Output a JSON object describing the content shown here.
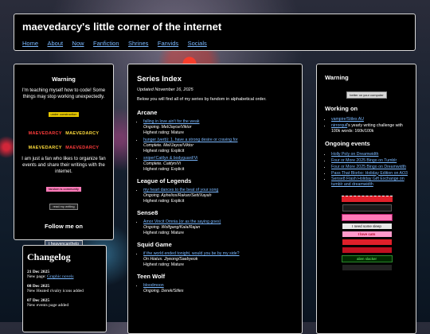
{
  "header": {
    "title": "maevedarcy's little corner of the internet",
    "nav": [
      "Home",
      "About",
      "Now",
      "Fanfiction",
      "Shrines",
      "Fanvids",
      "Socials"
    ]
  },
  "left": {
    "warning_heading": "Warning",
    "warning_text": "I'm teaching myself how to code! Some things may stop working unexpectedly.",
    "construction_badge": "under construction",
    "maeve_badge_text": "MAEVEDARCY",
    "fan_text": "I am just a fan who likes to organize fan events and share their writings with the internet.",
    "badge_pink": "fandom is community",
    "badge_reading": "read my writing",
    "follow_heading": "Follow me on",
    "tumblr_label": "heavencanthelp"
  },
  "changelog": {
    "title": "Changelog",
    "entries": [
      {
        "date": "21 Dec 2025",
        "prefix": "New page: ",
        "link": "Graphic novels",
        "suffix": ""
      },
      {
        "date": "08 Dec 2025",
        "prefix": "New Heated rivalry icons added",
        "link": "",
        "suffix": ""
      },
      {
        "date": "07 Dec 2025",
        "prefix": "New events page added",
        "link": "",
        "suffix": ""
      }
    ]
  },
  "center": {
    "title": "Series Index",
    "updated": "Updated November 16, 2025",
    "intro": "Below you will find all of my series by fandom in alphabetical order.",
    "fandoms": [
      {
        "name": "Arcane",
        "series": [
          {
            "title": "falling in love ain't for the weak",
            "status": "Ongoing. Mel/Jayce/Viktor",
            "rating": "Highest rating: Mature"
          },
          {
            "title": "hunger (verb): 1. have a strong desire or craving for",
            "status": "Complete. Mel/Jayce/Viktor",
            "rating": "Highest rating: Explicit"
          },
          {
            "title": "sniper!Caitlyn & bodyguard!Vi",
            "status": "Complete. Caitlyn/Vi",
            "rating": "Highest rating: Explicit"
          }
        ]
      },
      {
        "name": "League of Legends",
        "series": [
          {
            "title": "my heart dances to the beat of your song",
            "status": "Ongoing. Aphelios/Rakan/Sett/Xayah",
            "rating": "Highest rating: Explicit"
          }
        ]
      },
      {
        "name": "Sense8",
        "series": [
          {
            "title": "Amor Vincit Omnia (or as the saying goes)",
            "status": "Ongoing. Wolfgang/Kala/Rajan",
            "rating": "Highest rating: Mature"
          }
        ]
      },
      {
        "name": "Squid Game",
        "series": [
          {
            "title": "if the world ended tonight, would you be by my side?",
            "status": "On Hiatus. Jiyeong/Saebyeok",
            "rating": "Highest rating: Mature"
          }
        ]
      },
      {
        "name": "Teen Wolf",
        "series": [
          {
            "title": "bloodmoon",
            "status": "Ongoing. Derek/Stiles",
            "rating": ""
          }
        ]
      }
    ]
  },
  "right": {
    "warning_heading": "Warning",
    "warning_button": "better on your computer",
    "working_heading": "Working on",
    "working": [
      {
        "link": "vampire!Stiles AU",
        "text": ""
      },
      {
        "link": "nirrorquil",
        "text": "'s yearly writing challenge with 100k words: 160k/100k"
      }
    ],
    "events_heading": "Ongoing events",
    "events": [
      "Holly Poly on Dreamwidth",
      "Four or More 2025 Bingo on Tumblr",
      "Four or More 2025 Bingo on Dreamwidth",
      "Pass That Blorbo: Holiday Edition on AO3",
      "Sense8 Flash Holiday Gift Exchange on tumblr and dreamwidth"
    ],
    "stamps": [
      "",
      "",
      "",
      "I need some sleep",
      "I love cats",
      "",
      "",
      "alien slacker",
      ""
    ]
  },
  "colors": {
    "link": "#7ab8ff",
    "panel": "#000000",
    "border": "#d8d8d8",
    "stamp_red": "#e0202a",
    "stamp_pink": "#ff7ab8"
  }
}
